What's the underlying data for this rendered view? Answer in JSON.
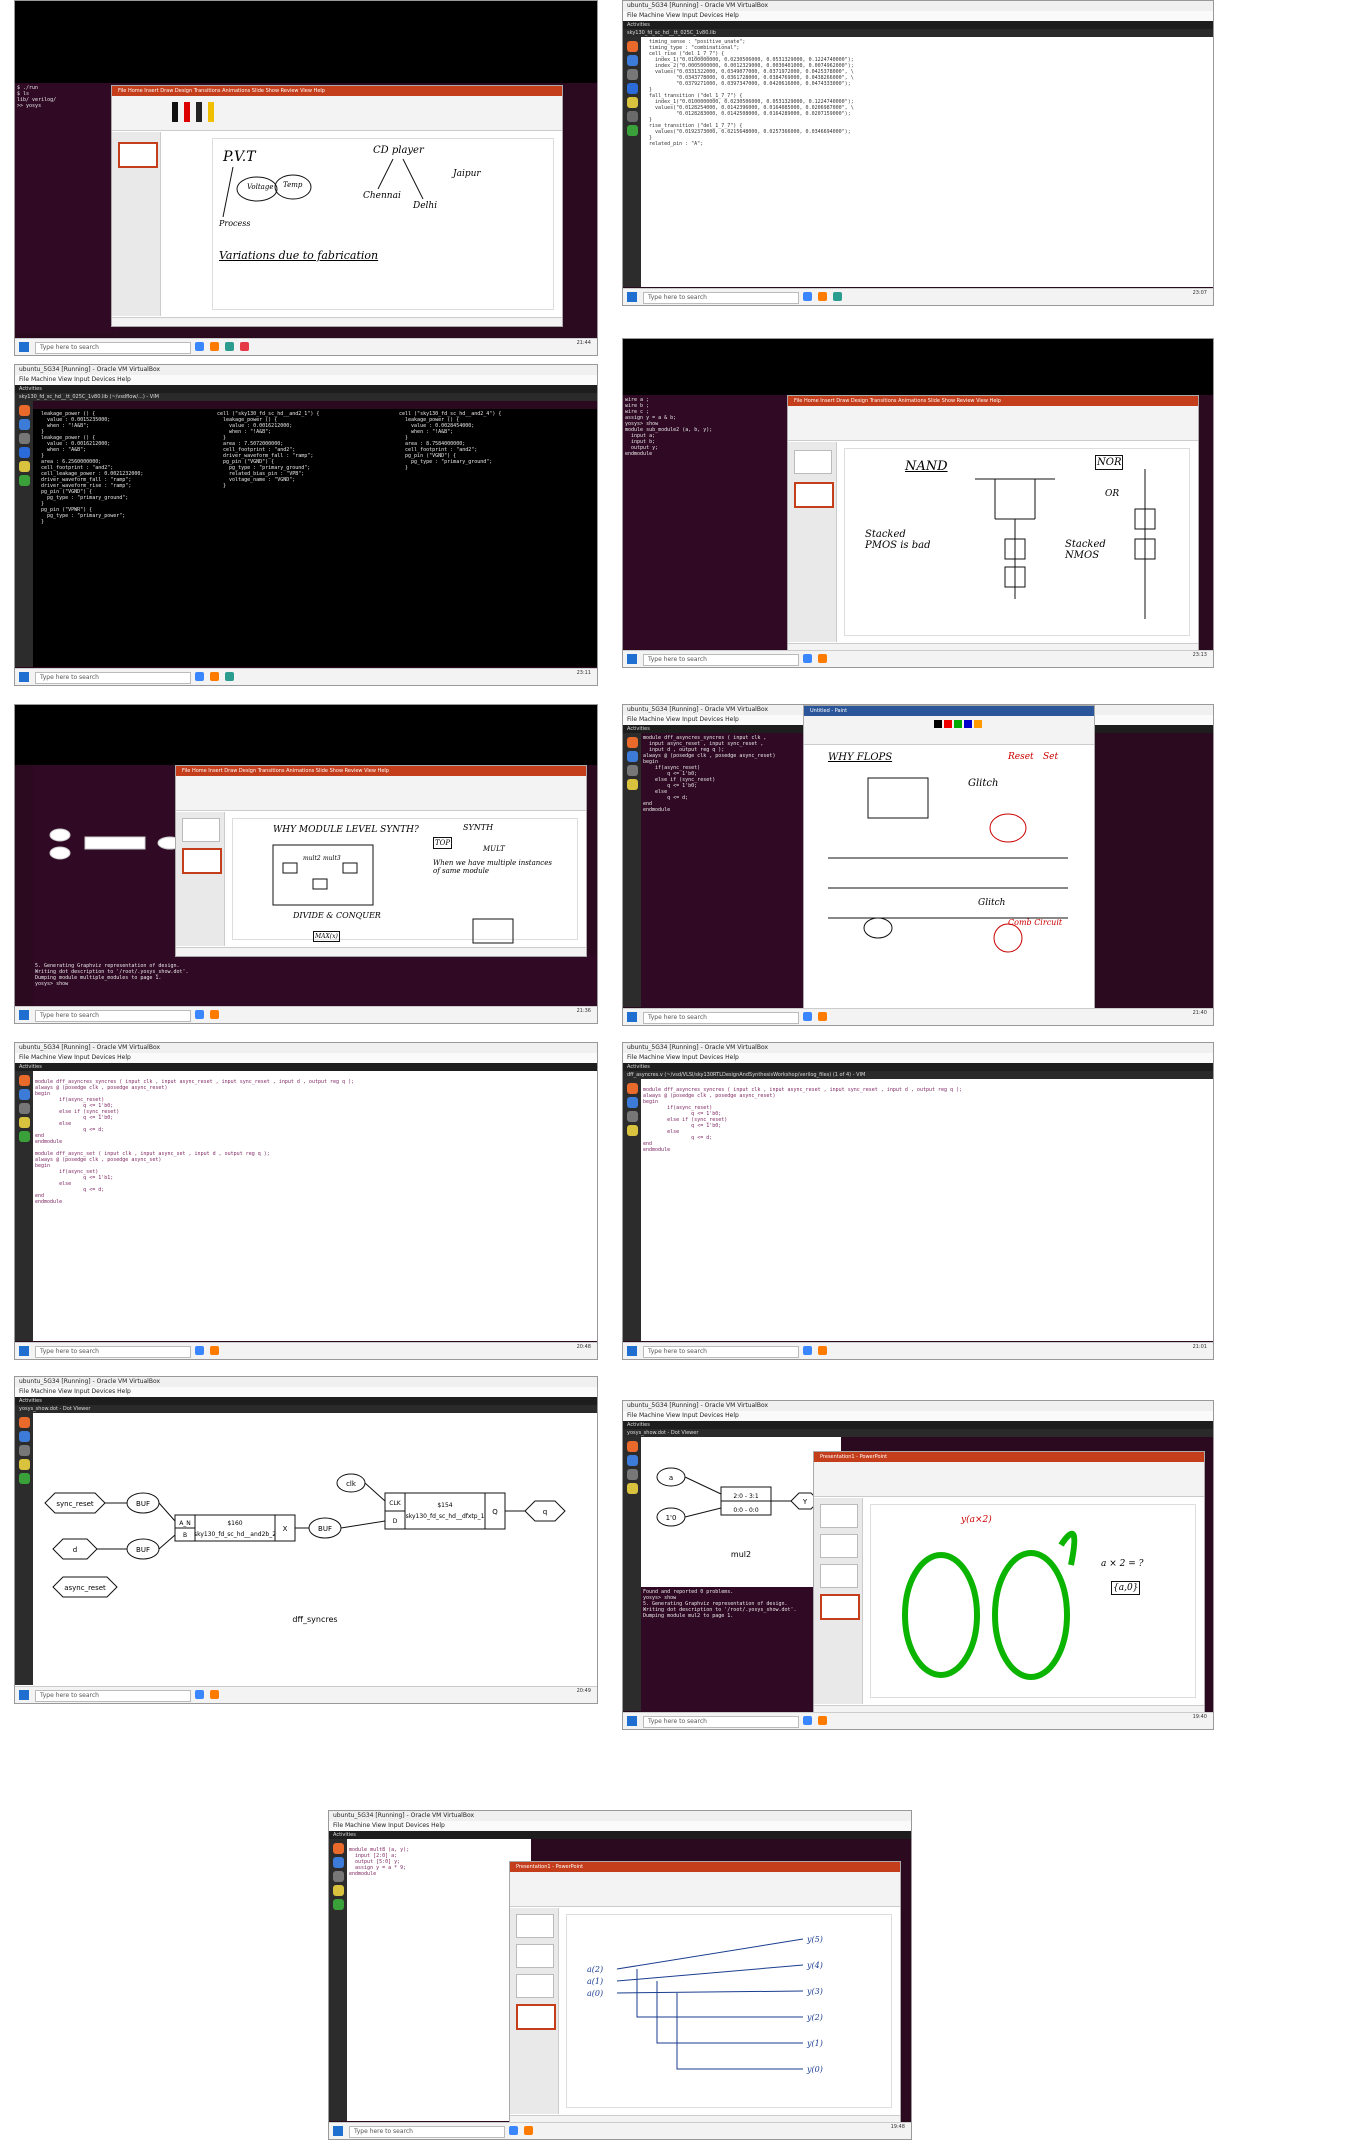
{
  "vbox_title": "ubuntu_5G34 [Running] - Oracle VM VirtualBox",
  "vbox_menu": "File  Machine  View  Input  Devices  Help",
  "search_placeholder": "Type here to search",
  "activities": "Activities",
  "shot1": {
    "slide_words": [
      "P.V.T",
      "Voltage",
      "Process",
      "Temp",
      "CD player",
      "Chennai",
      "Jaipur",
      "Delhi",
      "Variations due to fabrication"
    ],
    "clock": "21:44"
  },
  "shot2": {
    "title": "sky130_fd_sc_hd__tt_025C_1v80.lib",
    "clock": "23:07"
  },
  "shot3": {
    "title": "sky130_fd_sc_hd__tt_025C_1v80.lib (~/vsdflow/...) - VIM",
    "clock": "23:11"
  },
  "shot4": {
    "slide_words": [
      "NAND",
      "NOR",
      "Stacked PMOS is bad",
      "Stacked NMOS",
      "OR"
    ],
    "clock": "23:13"
  },
  "shot5": {
    "slide_words": [
      "WHY MODULE LEVEL SYNTH?",
      "SYNTH",
      "TOP",
      "MULT",
      "When we have multiple instances of same module",
      "DIVIDE & CONQUER",
      "mult2",
      "mult3",
      "MAX(x)"
    ],
    "terminal_lines": [
      "5. Generating Graphviz representation of design.",
      "Writing dot description to '/root/.yosys_show.dot'.",
      "Dumping module multiple_modules to page 1.",
      "yosys> show"
    ],
    "clock": "21:36"
  },
  "shot6": {
    "paint_title": "Untitled - Paint",
    "slide_words": [
      "WHY FLOPS",
      "Glitch",
      "Reset",
      "Set",
      "Glitch",
      "Comb Circuit"
    ],
    "clock": "21:40"
  },
  "shot7": {
    "code": [
      "module dff_asyncres_syncres ( input clk , input async_reset , input sync_reset , input d , output reg q );",
      "always @ (posedge clk , posedge async_reset)",
      "begin",
      "\tif(async_reset)",
      "\t\tq <= 1'b0;",
      "\telse if (sync_reset)",
      "\t\tq <= 1'b0;",
      "\telse",
      "\t\tq <= d;",
      "end",
      "endmodule",
      "",
      "module dff_async_set ( input clk , input async_set , input d , output reg q );",
      "always @ (posedge clk , posedge async_set)",
      "begin",
      "\tif(async_set)",
      "\t\tq <= 1'b1;",
      "\telse",
      "\t\tq <= d;",
      "end",
      "endmodule"
    ],
    "clock": "20:48"
  },
  "shot8": {
    "title": "dff_asyncres.v (~/vsd/VLSI/sky130RTLDesignAndSynthesisWorkshop/verilog_files) (1 of 4) - VIM",
    "clock": "21:01"
  },
  "shot9": {
    "viewer_title": "yosys_show.dot - Dot Viewer",
    "nodes": {
      "sync_reset": "sync_reset",
      "d": "d",
      "async_reset": "async_reset",
      "buf1": "BUF",
      "buf2": "BUF",
      "buf3": "BUF",
      "and_a": "A_N",
      "and_b": "B",
      "and_id": "$160",
      "and_type": "sky130_fd_sc_hd__and2b_2",
      "and_out": "X",
      "clk": "clk",
      "dff_clk": "CLK",
      "dff_d": "D",
      "dff_id": "$154",
      "dff_type": "sky130_fd_sc_hd__dfxtp_1",
      "dff_q": "Q",
      "q": "q"
    },
    "caption": "dff_syncres",
    "clock": "20:49"
  },
  "shot10": {
    "viewer_title": "yosys_show.dot - Dot Viewer",
    "nodes": {
      "a": "a",
      "one_zero": "1'0",
      "slice_top": "2:0 - 3:1",
      "slice_bottom": "0:0 - 0:0",
      "y": "Y"
    },
    "caption": "mul2",
    "ppt_title": "Presentation1 - PowerPoint",
    "slide_words": [
      "a × 2 = ?",
      "{a,0}",
      "y(a×2)"
    ],
    "clock": "19:40"
  },
  "shot11": {
    "code": [
      "module mult8 (a, y);",
      "  input [2:0] a;",
      "  output [5:0] y;",
      "  assign y = a * 9;",
      "endmodule"
    ],
    "ppt_title": "Presentation1 - PowerPoint",
    "slide_words": [
      "a(2)",
      "a(1)",
      "a(0)",
      "y(5)",
      "y(4)",
      "y(3)",
      "y(2)",
      "y(1)",
      "y(0)"
    ],
    "clock": "19:48"
  },
  "colors": {
    "terminal": "#300a24",
    "ppt_accent": "#c43e1c",
    "ubuntu_bar": "#1d1d1d"
  }
}
